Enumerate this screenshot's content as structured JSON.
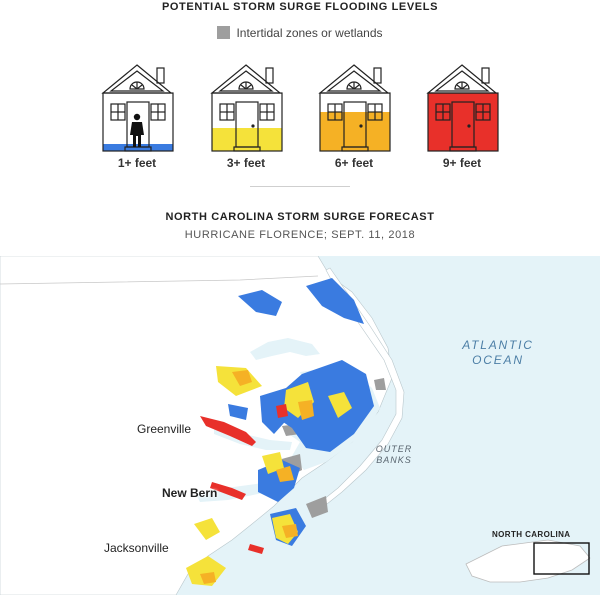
{
  "legend": {
    "title": "POTENTIAL STORM SURGE FLOODING LEVELS",
    "intertidal_label": "Intertidal zones or wetlands",
    "intertidal_color": "#9e9e9e",
    "levels": [
      {
        "label": "1+ feet",
        "color": "#3a7be0",
        "fill_fraction": 0.08
      },
      {
        "label": "3+ feet",
        "color": "#f5e23a",
        "fill_fraction": 0.33
      },
      {
        "label": "6+ feet",
        "color": "#f5b125",
        "fill_fraction": 0.66
      },
      {
        "label": "9+ feet",
        "color": "#e8302a",
        "fill_fraction": 1.0
      }
    ]
  },
  "map": {
    "title": "NORTH CAROLINA STORM SURGE FORECAST",
    "subtitle": "HURRICANE FLORENCE; SEPT. 11, 2018",
    "ocean_label_line1": "ATLANTIC",
    "ocean_label_line2": "OCEAN",
    "banks_label_line1": "OUTER",
    "banks_label_line2": "BANKS",
    "cities": {
      "greenville": "Greenville",
      "new_bern": "New Bern",
      "jacksonville": "Jacksonville"
    },
    "inset_label": "NORTH CAROLINA",
    "water_color": "#e4f3f8",
    "land_color": "#ffffff"
  }
}
